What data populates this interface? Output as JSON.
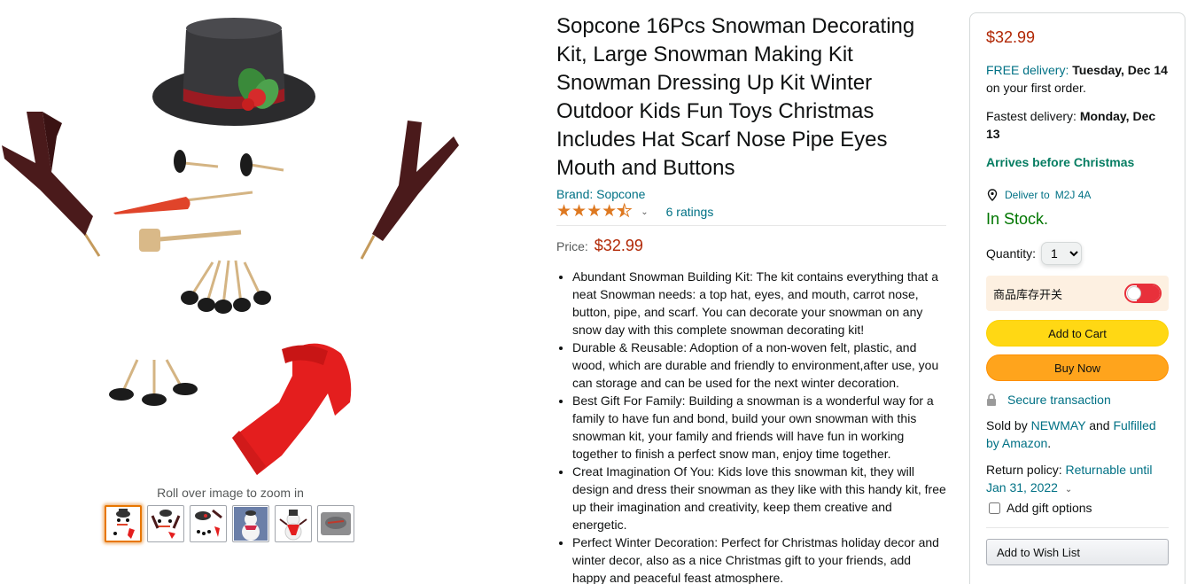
{
  "gallery": {
    "zoom_hint": "Roll over image to zoom in",
    "thumbnails": [
      "thumb-kit-laid-out",
      "thumb-kit-pieces",
      "thumb-kit-hat-buttons",
      "thumb-snowman-photo",
      "thumb-snowman-scarf",
      "thumb-packaging"
    ]
  },
  "product": {
    "title": "Sopcone 16Pcs Snowman Decorating Kit, Large Snowman Making Kit Snowman Dressing Up Kit Winter Outdoor Kids Fun Toys Christmas Includes Hat Scarf Nose Pipe Eyes Mouth and Buttons",
    "brand": "Brand: Sopcone",
    "rating_stars": 4.5,
    "ratings_count": "6 ratings",
    "price_label": "Price:",
    "price": "$32.99",
    "bullets": [
      "Abundant Snowman Building Kit: The kit contains everything that a neat Snowman needs: a top hat, eyes, and mouth, carrot nose, button, pipe, and scarf. You can decorate your snowman on any snow day with this complete snowman decorating kit!",
      "Durable & Reusable: Adoption of a non-woven felt, plastic, and wood, which are durable and friendly to environment,after use, you can storage and can be used for the next winter decoration.",
      "Best Gift For Family: Building a snowman is a wonderful way for a family to have fun and bond, build your own snowman with this snowman kit, your family and friends will have fun in working together to finish a perfect snow man, enjoy time together.",
      "Creat Imagination Of You: Kids love this snowman kit, they will design and dress their snowman as they like with this handy kit, free up their imagination and creativity, keep them creative and energetic.",
      "Perfect Winter Decoration: Perfect for Christmas holiday decor and winter decor, also as a nice Christmas gift to your friends, add happy and peaceful feast atmosphere."
    ]
  },
  "buybox": {
    "price": "$32.99",
    "free_delivery_link": "FREE delivery:",
    "free_delivery_date": "Tuesday, Dec 14",
    "free_delivery_note": "on your first order.",
    "fastest_label": "Fastest delivery:",
    "fastest_date": "Monday, Dec 13",
    "arrives": "Arrives before Christmas",
    "deliver_to": "Deliver to",
    "postal_code": "M2J 4A",
    "stock": "In Stock.",
    "quantity_label": "Quantity:",
    "quantity_value": "1",
    "inventory_toggle_label": "商品库存开关",
    "inventory_toggle_on": false,
    "add_to_cart": "Add to Cart",
    "buy_now": "Buy Now",
    "secure": "Secure transaction",
    "sold_by_prefix": "Sold by",
    "seller": "NEWMAY",
    "sold_by_and": "and",
    "fulfilled": "Fulfilled by Amazon",
    "return_label": "Return policy:",
    "return_link": "Returnable until Jan 31, 2022",
    "gift_label": "Add gift options",
    "wish_list": "Add to Wish List"
  },
  "colors": {
    "price": "#b12704",
    "link": "#007185",
    "in_stock": "#007600",
    "arrives": "#067d62",
    "add_to_cart": "#ffd814",
    "buy_now": "#ffa41c",
    "star": "#de7921"
  }
}
